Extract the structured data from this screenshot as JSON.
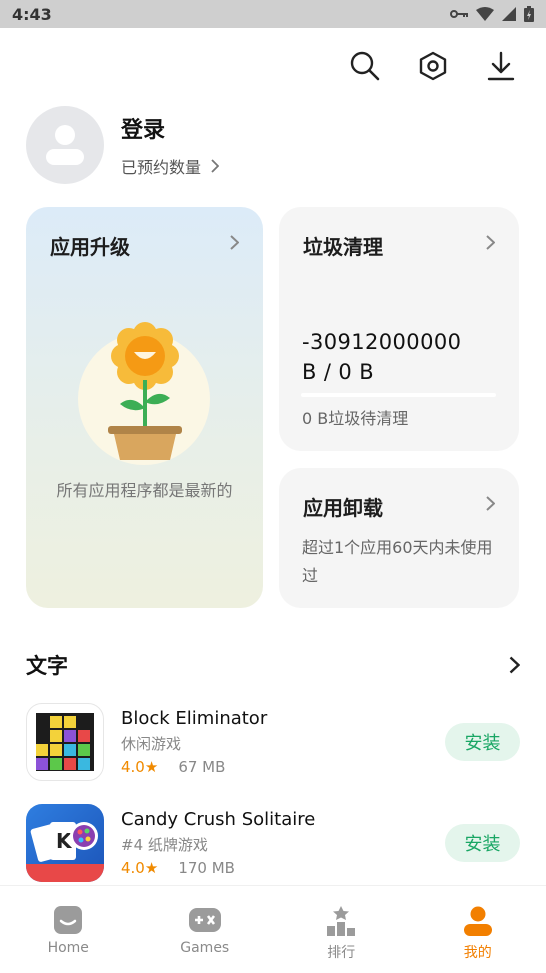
{
  "status": {
    "time": "4:43"
  },
  "header": {
    "icons": [
      "search-icon",
      "settings-icon",
      "download-icon"
    ]
  },
  "profile": {
    "login_label": "登录",
    "reserved_label": "已预约数量"
  },
  "cards": {
    "upgrade": {
      "title": "应用升级",
      "message": "所有应用程序都是最新的"
    },
    "trash": {
      "title": "垃圾清理",
      "size_line1": "-30912000000",
      "size_line2": "B / 0 B",
      "note": "0 B垃圾待清理"
    },
    "uninstall": {
      "title": "应用卸载",
      "note": "超过1个应用60天内未使用过"
    }
  },
  "section": {
    "title": "文字"
  },
  "apps": [
    {
      "name": "Block Eliminator",
      "category": "休闲游戏",
      "rating": "4.0★",
      "size": "67 MB",
      "button": "安装"
    },
    {
      "name": "Candy Crush Solitaire",
      "category": "#4 纸牌游戏",
      "rating": "4.0★",
      "size": "170 MB",
      "button": "安装"
    }
  ],
  "nav": [
    {
      "label": "Home"
    },
    {
      "label": "Games"
    },
    {
      "label": "排行"
    },
    {
      "label": "我的"
    }
  ],
  "colors": {
    "accent": "#f27f00",
    "install_green": "#19a664"
  }
}
